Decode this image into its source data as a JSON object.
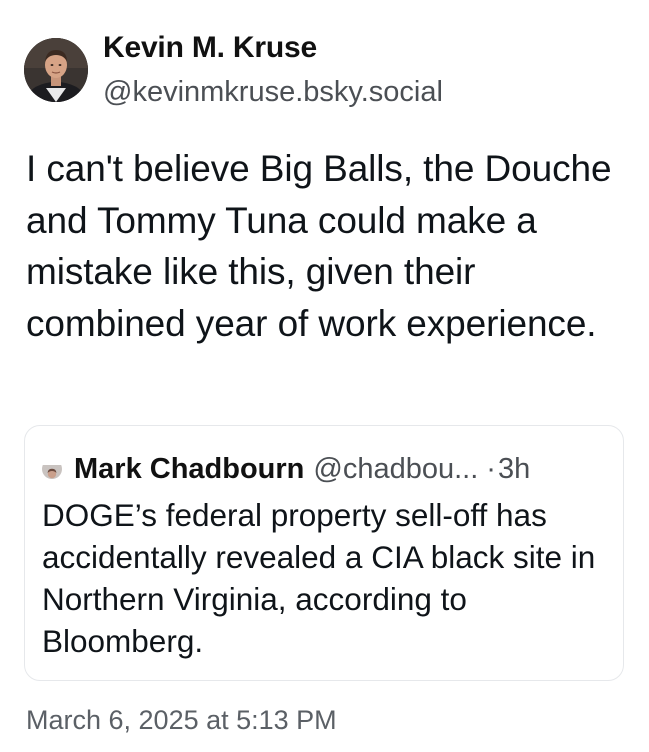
{
  "post": {
    "author": {
      "display_name": "Kevin M. Kruse",
      "handle": "@kevinmkruse.bsky.social",
      "avatar_icon": "profile-photo"
    },
    "text": "I can't believe Big Balls, the Douche and Tommy Tuna could make a mistake like this, given their combined year of work experience.",
    "timestamp": "March 6, 2025 at 5:13 PM"
  },
  "quote": {
    "author": {
      "display_name": "Mark Chadbourn",
      "handle": "@chadbou...",
      "avatar_icon": "profile-photo"
    },
    "separator": "·",
    "time": "3h",
    "text": "DOGE’s federal property sell-off has accidentally revealed a CIA black site in Northern Virginia, according to Bloomberg."
  },
  "colors": {
    "text_primary": "#0f1419",
    "text_secondary": "#4b4f54",
    "card_border": "#e6e8eb",
    "background": "#ffffff"
  }
}
